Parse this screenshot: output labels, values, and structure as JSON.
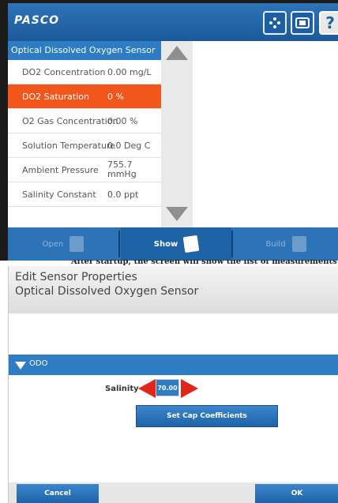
{
  "header": {
    "logo": "PASCO",
    "help_label": "?"
  },
  "sensor_list": {
    "title": "Optical Dissolved Oxygen Sensor",
    "rows": [
      {
        "name": "DO2 Concentration",
        "value": "0.00 mg/L"
      },
      {
        "name": "DO2 Saturation",
        "value": "0 %"
      },
      {
        "name": "O2 Gas Concentration",
        "value": "0.00 %"
      },
      {
        "name": "Solution Temperature",
        "value": "0.0 Deg C"
      },
      {
        "name": "Ambient Pressure",
        "value_line1": "755.7",
        "value_line2": "mmHg"
      },
      {
        "name": "Salinity Constant",
        "value": "0.0 ppt"
      }
    ],
    "selected_index": 1
  },
  "tabs": {
    "open": "Open",
    "show": "Show",
    "build": "Build"
  },
  "caption": "After startup, the screen will show the list of measurements",
  "dialog": {
    "title_line1": "Edit Sensor Properties",
    "title_line2": "Optical Dissolved Oxygen Sensor",
    "section": "ODO",
    "salinity_label": "Salinity",
    "salinity_value": "70.00",
    "set_cap_button": "Set Cap Coefficients",
    "cancel_button": "Cancel",
    "ok_button": "OK"
  },
  "colors": {
    "accent": "#2d7cc4",
    "selected": "#f2561a",
    "arrow": "#e2261a"
  }
}
